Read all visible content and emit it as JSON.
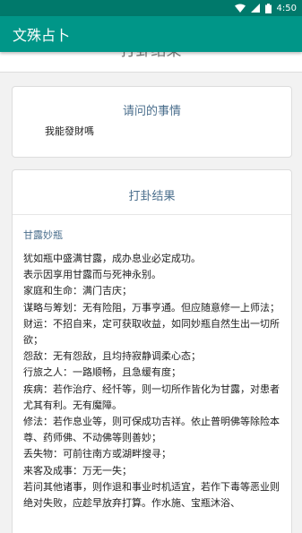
{
  "status_bar": {
    "time": "4:50"
  },
  "app_bar": {
    "title": "文殊占卜"
  },
  "top_strip": {
    "text": "打卦结果"
  },
  "question_card": {
    "title": "请问的事情",
    "question": "我能發財嗎"
  },
  "result_card": {
    "title": "打卦结果",
    "gua_name": "甘露妙瓶",
    "lines": [
      "犹如瓶中盛满甘露，成办息业必定成功。",
      "表示因享用甘露而与死神永别。",
      "家庭和生命：满门吉庆；",
      "谋略与筹划：无有险阻，万事亨通。但应随意修一上师法；",
      "财运：不招自来，定可获取收益，如同妙瓶自然生出一切所欲；",
      "怨敌：无有怨敌，且均持寂静调柔心态；",
      "行旅之人：一路顺畅，且急缓有度；",
      "疾病：若作治疗、经忏等，则一切所作皆化为甘露，对患者尤其有利。无有魔障。",
      "修法：若作息业等，则可保成功吉祥。依止普明佛等除险本尊、药师佛、不动佛等则善妙；",
      "丢失物：可前往南方或湖畔搜寻；",
      "来客及成事：万无一失；",
      "若问其他诸事，则作退和事业时机适宜，若作下毒等恶业则绝对失败，应趁早放弃打算。作水施、宝瓶沐浴、"
    ]
  },
  "colors": {
    "status_bar": "#00796b",
    "app_bar": "#009688",
    "accent_text": "#4a6e8c"
  }
}
